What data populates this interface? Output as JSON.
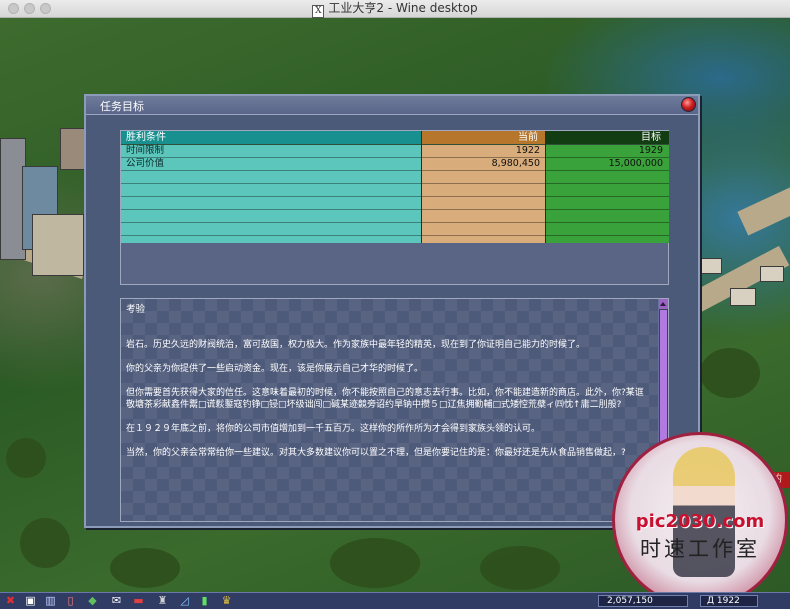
{
  "window": {
    "title": "工业大亨2 - Wine desktop"
  },
  "dialog": {
    "title": "任务目标",
    "goals": {
      "headers": {
        "label": "胜利条件",
        "current": "当前",
        "target": "目标"
      },
      "rows": [
        {
          "label": "时间限制",
          "current": "1922",
          "target": "1929"
        },
        {
          "label": "公司价值",
          "current": "8,980,450",
          "target": "15,000,000"
        }
      ]
    },
    "description": {
      "heading": "考验",
      "paragraphs": [
        "岩石。历史久远的财阀统治，富可敌国，权力极大。作为家族中最年轻的精英，现在到了你证明自己能力的时候了。",
        "你的父亲为你提供了一些启动资金。现在，该是你展示自己才华的时候了。",
        "但你需要首先获得大家的信任。这意味着最初的时候，你不能按照自己的意志去行事。比如，你不能建造新的商店。此外，你?某诓敬塘茶彩献鑫件鬻□谎鬏鏨寇钓铮□锓□坏级诎闯□碱某迹竸旁诏约旱钠中攒５□辽焦拥勤輔□式矮悾荒蘗ィ㈣忱↑庸二刖般?",
        "在１９２９年底之前，将你的公司市值增加到一千五百万。这样你的所作所为才会得到家族头领的认可。",
        "当然，你的父亲会常常给你一些建议。对其大多数建议你可以置之不理，但是你要记住的是：你最好还是先从食品销售做起，?"
      ]
    }
  },
  "watermark": {
    "site": "pic2030.com",
    "studio": "时速工作室"
  },
  "banner": {
    "text": "罗克汉首领的"
  },
  "status": {
    "money": "2,057,150",
    "date": "Д 1922"
  },
  "taskbar_icons": [
    "close-x-icon",
    "save-disk-icon",
    "building-icon",
    "document-icon",
    "train-icon",
    "mail-icon",
    "car-icon",
    "factory-icon",
    "chart-icon",
    "bar-chart-icon",
    "trophy-icon"
  ]
}
